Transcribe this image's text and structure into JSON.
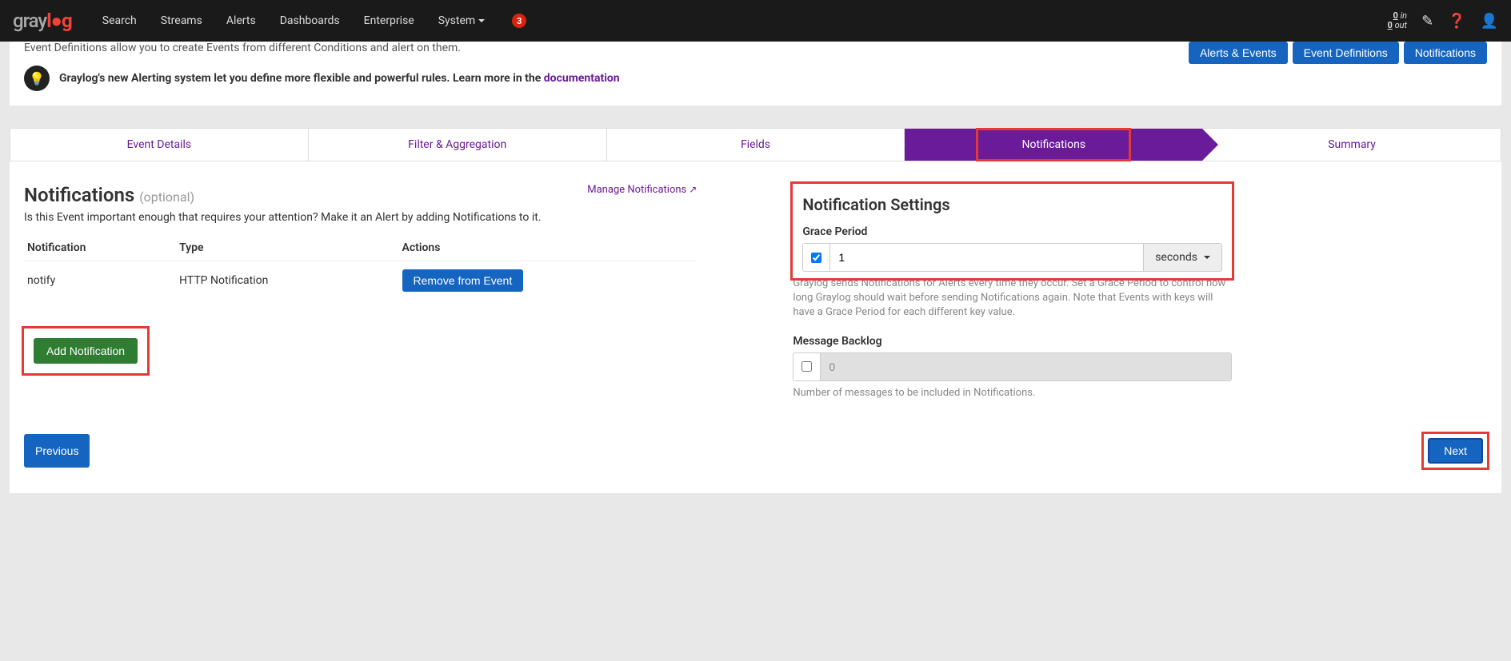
{
  "nav": {
    "logo": "graylog",
    "items": [
      "Search",
      "Streams",
      "Alerts",
      "Dashboards",
      "Enterprise",
      "System"
    ],
    "badge": "3",
    "throughput_in": "0",
    "throughput_out": "0",
    "throughput_in_label": "in",
    "throughput_out_label": "out"
  },
  "header": {
    "desc": "Event Definitions allow you to create Events from different Conditions and alert on them.",
    "info": "Graylog's new Alerting system let you define more flexible and powerful rules. Learn more in the ",
    "info_link": "documentation",
    "buttons": [
      "Alerts & Events",
      "Event Definitions",
      "Notifications"
    ]
  },
  "wizard": [
    "Event Details",
    "Filter & Aggregation",
    "Fields",
    "Notifications",
    "Summary"
  ],
  "left": {
    "title": "Notifications",
    "optional": "(optional)",
    "manage": "Manage Notifications",
    "help": "Is this Event important enough that requires your attention? Make it an Alert by adding Notifications to it.",
    "table": {
      "headers": [
        "Notification",
        "Type",
        "Actions"
      ],
      "row": {
        "name": "notify",
        "type": "HTTP Notification",
        "action": "Remove from Event"
      }
    },
    "add_btn": "Add Notification"
  },
  "right": {
    "title": "Notification Settings",
    "grace_label": "Grace Period",
    "grace_value": "1",
    "grace_unit": "seconds",
    "grace_hint": "Graylog sends Notifications for Alerts every time they occur. Set a Grace Period to control how long Graylog should wait before sending Notifications again. Note that Events with keys will have a Grace Period for each different key value.",
    "backlog_label": "Message Backlog",
    "backlog_value": "0",
    "backlog_hint": "Number of messages to be included in Notifications."
  },
  "footer": {
    "prev": "Previous",
    "next": "Next"
  }
}
